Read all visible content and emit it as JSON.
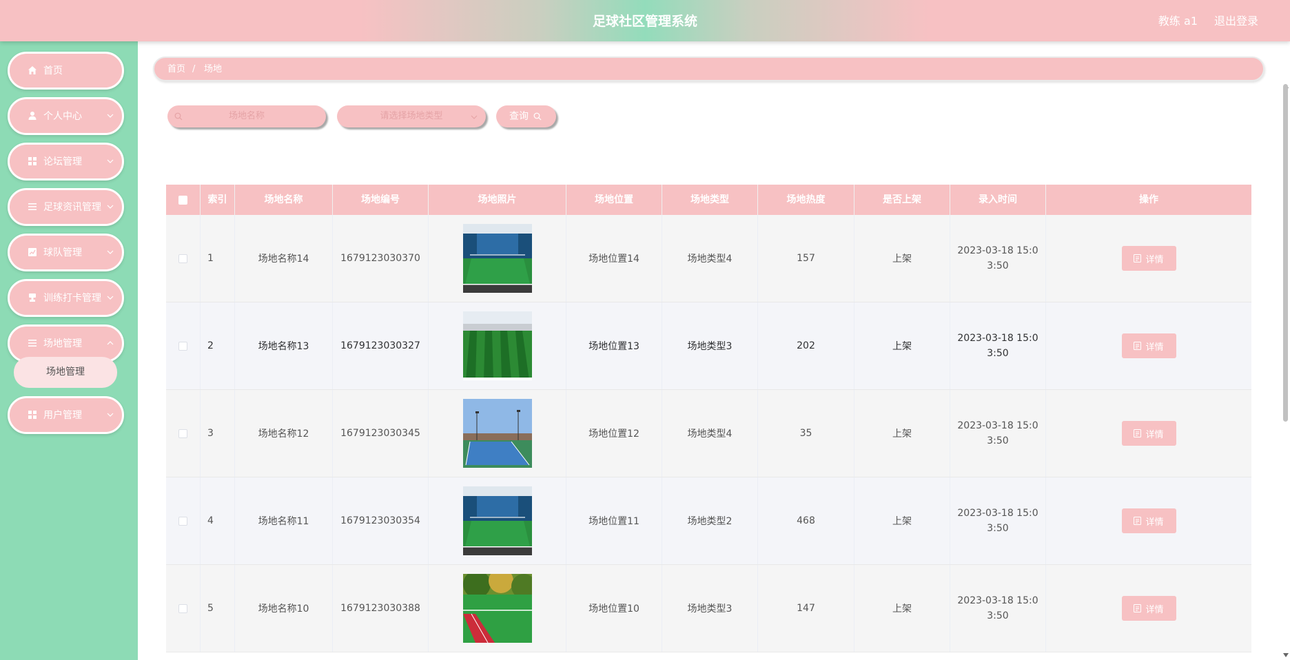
{
  "app": {
    "title": "足球社区管理系统",
    "user": "教练 a1",
    "logout": "退出登录"
  },
  "colors": {
    "accent": "#f7c1c3",
    "sidebar": "#8ddbb5",
    "text": "#555555"
  },
  "sidebar": {
    "items": [
      {
        "label": "首页",
        "icon": "home-icon",
        "has_arrow": false
      },
      {
        "label": "个人中心",
        "icon": "user-icon",
        "has_arrow": true
      },
      {
        "label": "论坛管理",
        "icon": "grid-icon",
        "has_arrow": true
      },
      {
        "label": "足球资讯管理",
        "icon": "list-icon",
        "has_arrow": true
      },
      {
        "label": "球队管理",
        "icon": "chart-icon",
        "has_arrow": true
      },
      {
        "label": "训练打卡管理",
        "icon": "stamp-icon",
        "has_arrow": true
      },
      {
        "label": "场地管理",
        "icon": "list-icon",
        "has_arrow": true
      },
      {
        "label": "用户管理",
        "icon": "grid-icon",
        "has_arrow": true
      }
    ],
    "submenu": {
      "label": "场地管理"
    }
  },
  "breadcrumb": {
    "home": "首页",
    "separator": "/",
    "current": "场地"
  },
  "search": {
    "name_placeholder": "场地名称",
    "type_placeholder": "请选择场地类型",
    "query_label": "查询"
  },
  "table": {
    "columns": [
      "索引",
      "场地名称",
      "场地编号",
      "场地照片",
      "场地位置",
      "场地类型",
      "场地热度",
      "是否上架",
      "录入时间",
      "操作"
    ],
    "detail_label": "详情",
    "rows": [
      {
        "index": "1",
        "name": "场地名称14",
        "code": "1679123030370",
        "photo": "indoor-pitch-photo",
        "location": "场地位置14",
        "type": "场地类型4",
        "heat": "157",
        "status": "上架",
        "time": "2023-03-18 15:03:50"
      },
      {
        "index": "2",
        "name": "场地名称13",
        "code": "1679123030327",
        "photo": "striped-pitch-photo",
        "location": "场地位置13",
        "type": "场地类型3",
        "heat": "202",
        "status": "上架",
        "time": "2023-03-18 15:03:50"
      },
      {
        "index": "3",
        "name": "场地名称12",
        "code": "1679123030345",
        "photo": "tennis-court-photo",
        "location": "场地位置12",
        "type": "场地类型4",
        "heat": "35",
        "status": "上架",
        "time": "2023-03-18 15:03:50"
      },
      {
        "index": "4",
        "name": "场地名称11",
        "code": "1679123030354",
        "photo": "indoor-pitch-photo",
        "location": "场地位置11",
        "type": "场地类型2",
        "heat": "468",
        "status": "上架",
        "time": "2023-03-18 15:03:50"
      },
      {
        "index": "5",
        "name": "场地名称10",
        "code": "1679123030388",
        "photo": "red-track-pitch-photo",
        "location": "场地位置10",
        "type": "场地类型3",
        "heat": "147",
        "status": "上架",
        "time": "2023-03-18 15:03:50"
      }
    ]
  }
}
